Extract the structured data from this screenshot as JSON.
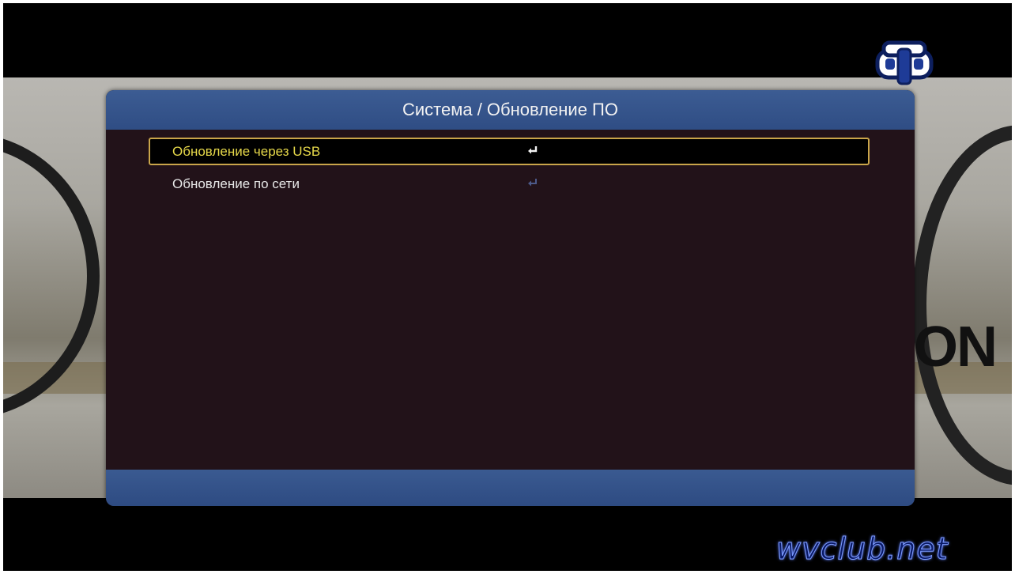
{
  "dialog": {
    "title": "Система / Обновление ПО",
    "items": [
      {
        "label": "Обновление через USB",
        "icon": "enter-icon",
        "selected": true
      },
      {
        "label": "Обновление по сети",
        "icon": "enter-icon",
        "selected": false
      }
    ]
  },
  "background": {
    "partial_word": "ON"
  },
  "watermark": "wvclub.net",
  "logo": "provider-logo",
  "colors": {
    "header": "#36558C",
    "selection_border": "#C9A54A",
    "selected_text": "#E7D94A",
    "panel": "#221219"
  }
}
